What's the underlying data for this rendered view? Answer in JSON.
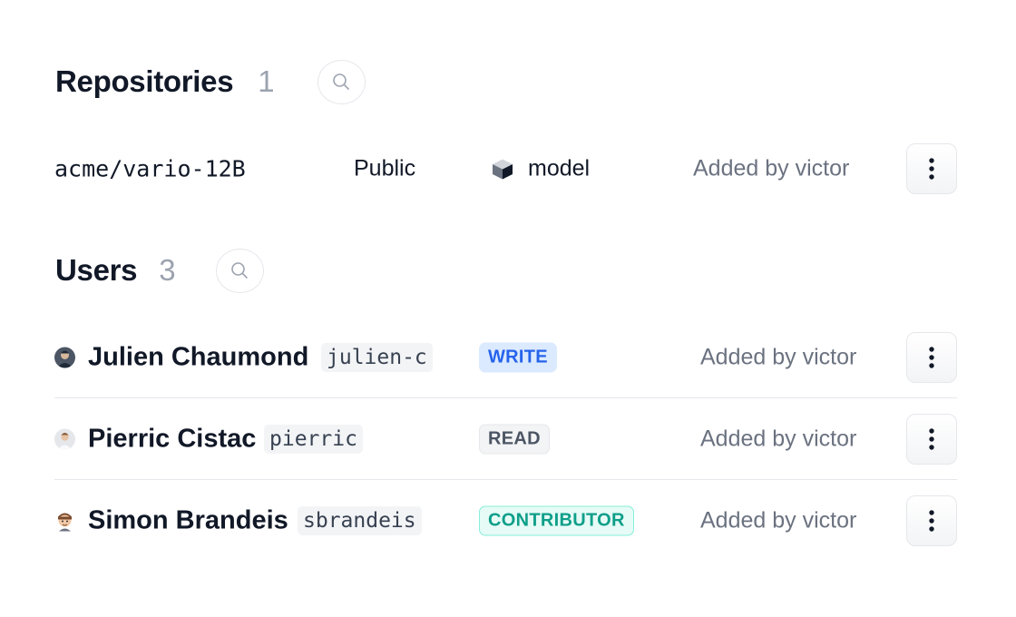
{
  "repositories": {
    "title": "Repositories",
    "count": "1",
    "items": [
      {
        "name": "acme/vario-12B",
        "visibility": "Public",
        "type": "model",
        "added_by": "Added by victor"
      }
    ]
  },
  "users": {
    "title": "Users",
    "count": "3",
    "items": [
      {
        "name": "Julien Chaumond",
        "handle": "julien-c",
        "role": "WRITE",
        "added_by": "Added by victor"
      },
      {
        "name": "Pierric Cistac",
        "handle": "pierric",
        "role": "READ",
        "added_by": "Added by victor"
      },
      {
        "name": "Simon Brandeis",
        "handle": "sbrandeis",
        "role": "CONTRIBUTOR",
        "added_by": "Added by victor"
      }
    ]
  },
  "icons": {
    "search": "search-icon",
    "menu": "more-vertical-icon",
    "model": "cube-icon"
  },
  "colors": {
    "write": "#2563eb",
    "read": "#4b5563",
    "contributor": "#0f9f8a",
    "muted": "#9ca3af"
  }
}
